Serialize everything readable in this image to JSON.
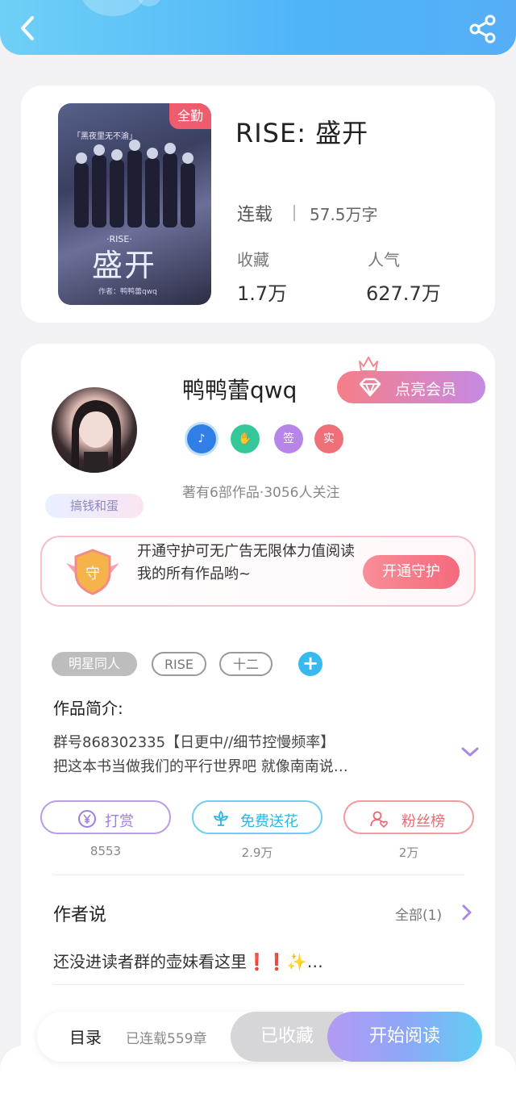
{
  "book": {
    "title": "RISE: 盛开",
    "cover": {
      "tag": "全勤",
      "slogan": "「黑夜里无不渝」",
      "big_title": "盛开",
      "small_title": "·RISE·",
      "credit": "作者：鸭鸭蕾qwq"
    },
    "status": "连载",
    "word_count": "57.5万字",
    "stats": [
      {
        "label": "收藏",
        "value": "1.7万"
      },
      {
        "label": "人气",
        "value": "627.7万"
      }
    ]
  },
  "author": {
    "name": "鸭鸭蕾qwq",
    "vip_label": "点亮会员",
    "badge_text": "搞钱和蛋",
    "medals": [
      {
        "icon": "music-medal-icon",
        "text": "♪",
        "color": "#2f7fe6"
      },
      {
        "icon": "handshake-medal-icon",
        "text": "✋",
        "color": "#34c79a"
      },
      {
        "icon": "sign-medal-icon",
        "text": "签",
        "color": "#b784e8"
      },
      {
        "icon": "verified-medal-icon",
        "text": "实",
        "color": "#ef6f78"
      }
    ],
    "works_info": "著有6部作品·3056人关注"
  },
  "guard": {
    "icon_text": "守",
    "text": "开通守护可无广告无限体力值阅读我的所有作品哟~",
    "button": "开通守护"
  },
  "tags": [
    "明星同人",
    "RISE",
    "十二"
  ],
  "intro": {
    "title": "作品简介:",
    "line1": "群号868302335【日更中//细节控慢频率】",
    "line2": "把这本书当做我们的平行世界吧 就像南南说…"
  },
  "actions": [
    {
      "label": "打赏",
      "count": "8553",
      "icon": "yen-icon",
      "color": "#a07ee0"
    },
    {
      "label": "免费送花",
      "count": "2.9万",
      "icon": "flower-icon",
      "color": "#38bde7"
    },
    {
      "label": "粉丝榜",
      "count": "2万",
      "icon": "fans-icon",
      "color": "#e86a72"
    }
  ],
  "author_says": {
    "title": "作者说",
    "all_label": "全部(1)",
    "text": "还没进读者群的壶妹看这里❗❗✨…"
  },
  "bottom_bar": {
    "toc": "目录",
    "serial_count": "已连载559章",
    "collected": "已收藏",
    "start_read": "开始阅读"
  }
}
